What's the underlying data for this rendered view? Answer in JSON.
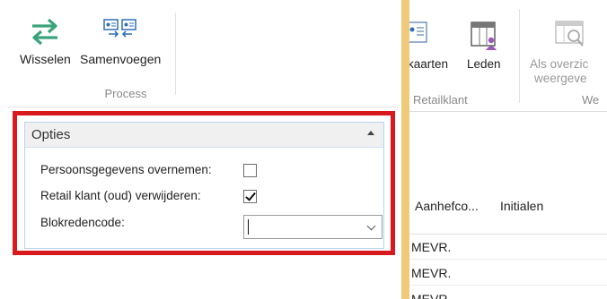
{
  "ribbon": {
    "swap_label": "Wisselen",
    "merge_label": "Samenvoegen",
    "process_group": "Process"
  },
  "options": {
    "title": "Opties",
    "copy_personal_data_label": "Persoonsgegevens overnemen:",
    "copy_personal_data_checked": false,
    "delete_retail_label": "Retail klant (oud) verwijderen:",
    "delete_retail_checked": true,
    "block_reason_label": "Blokredencode:",
    "block_reason_value": ""
  },
  "right_ribbon": {
    "cards_label": "kaarten",
    "members_label": "Leden",
    "overview_line1": "Als overzic",
    "overview_line2": "weergeve",
    "retail_group": "Retailklant",
    "we_group": "We"
  },
  "grid": {
    "col_salutation": "Aanhefco...",
    "col_initials": "Initialen",
    "rows": [
      "MEVR.",
      "MEVR.",
      "MEVR."
    ]
  },
  "colors": {
    "highlight_frame": "#d81a1f",
    "splitter": "#f1c97a",
    "panel_border": "#b9d3ee",
    "swap_icon": "#3aa37c",
    "member_icon": "#9b59b6"
  }
}
